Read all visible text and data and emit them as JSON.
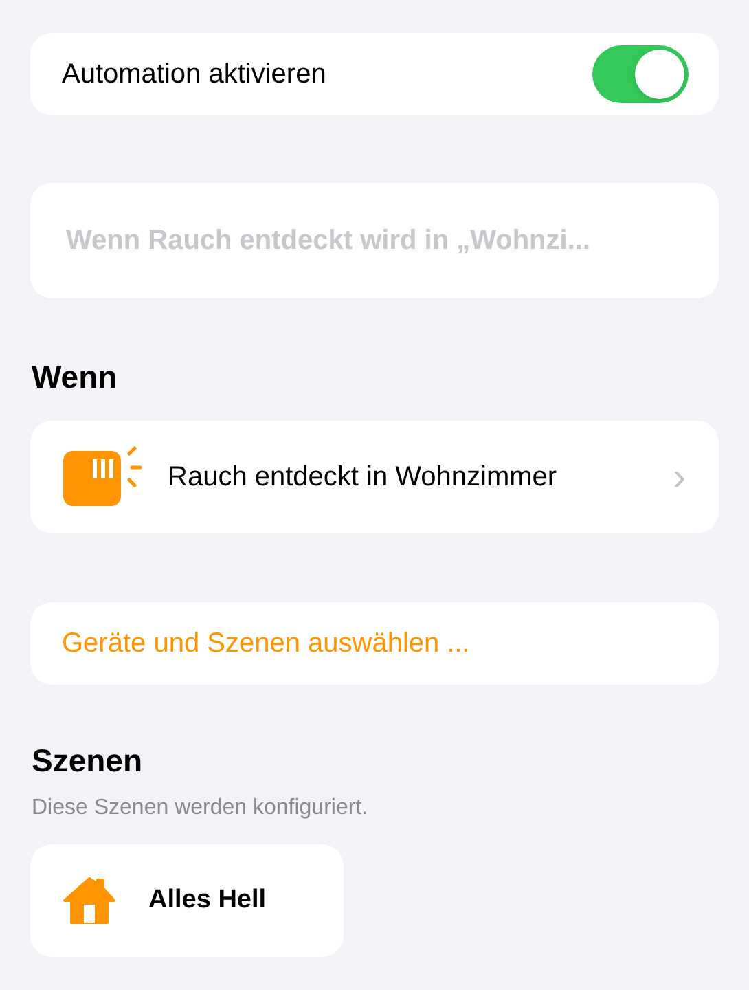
{
  "toggle_row": {
    "label": "Automation aktivieren",
    "on": true
  },
  "name_field": {
    "placeholder": "Wenn Rauch entdeckt wird in „Wohnzi..."
  },
  "trigger_section": {
    "heading": "Wenn",
    "item": {
      "label": "Rauch entdeckt in Wohnzimmer",
      "chevron": "›"
    }
  },
  "select_action": {
    "label": "Geräte und Szenen auswählen ..."
  },
  "scenes_section": {
    "heading": "Szenen",
    "subtitle": "Diese Szenen werden konfiguriert.",
    "scenes": [
      {
        "name": "Alles Hell"
      }
    ]
  }
}
